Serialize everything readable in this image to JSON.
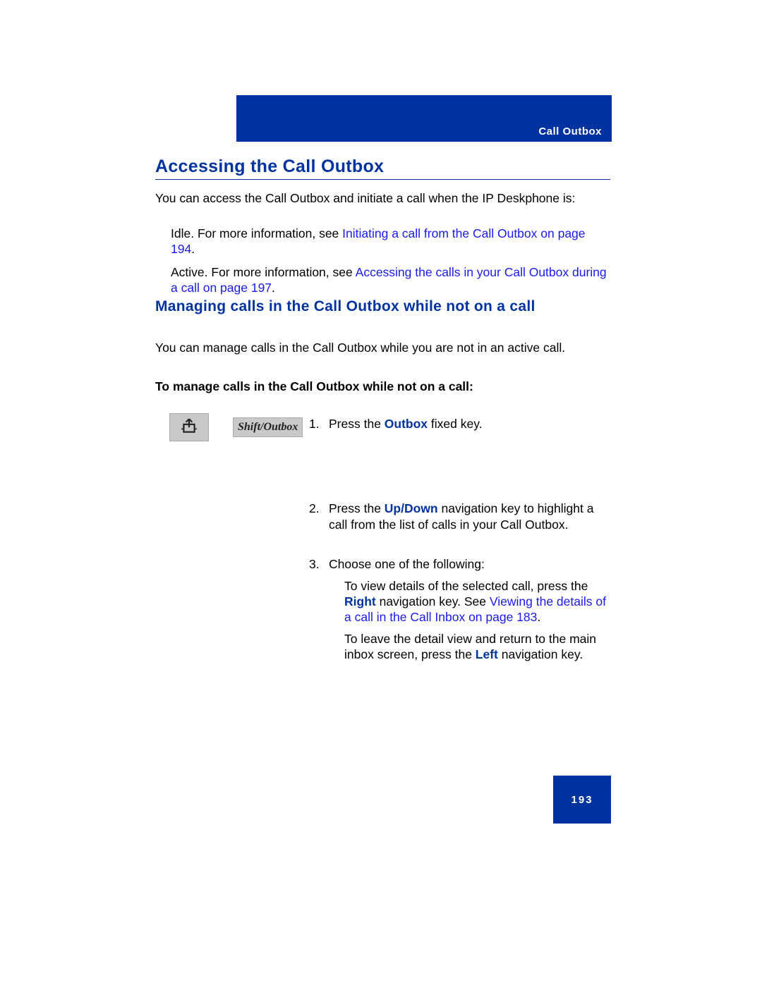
{
  "header": {
    "label": "Call Outbox"
  },
  "h1": "Accessing the Call Outbox",
  "intro": "You can access the Call Outbox and initiate a call when the IP Deskphone is:",
  "bullet1": {
    "prefix": "Idle. For more information, see  ",
    "link": "Initiating a call from the Call Outbox on page 194",
    "suffix": "."
  },
  "bullet2": {
    "prefix": "Active. For more information, see  ",
    "link": "Accessing the calls in your Call Outbox during a call  on page 197",
    "suffix": "."
  },
  "h2": "Managing calls in the Call Outbox while not on a call",
  "intro2": "You can manage calls in the Call Outbox while you are not in an active call.",
  "boldLine": "To manage calls in the Call Outbox while not on a call:",
  "keycap": {
    "label": "Shift/Outbox",
    "iconName": "outbox-icon"
  },
  "steps": {
    "s1": {
      "num": "1.",
      "t1": "Press the ",
      "kw": "Outbox",
      "t2": " fixed key."
    },
    "s2": {
      "num": "2.",
      "t1": "Press the ",
      "kw": "Up/Down",
      "t2": " navigation key to highlight a call from the list of calls in your Call Outbox."
    },
    "s3": {
      "num": "3.",
      "lead": "Choose one of the following:",
      "a": {
        "t1": "To view details of the selected call, press the ",
        "kw": "Right",
        "t2": " navigation key. See ",
        "link": "Viewing the details of a call in the Call Inbox  on page 183",
        "suffix": "."
      },
      "b": {
        "t1": "To leave the detail view and return to the main inbox screen, press the ",
        "kw": "Left",
        "t2": " navigation key."
      }
    }
  },
  "pageNumber": "193"
}
